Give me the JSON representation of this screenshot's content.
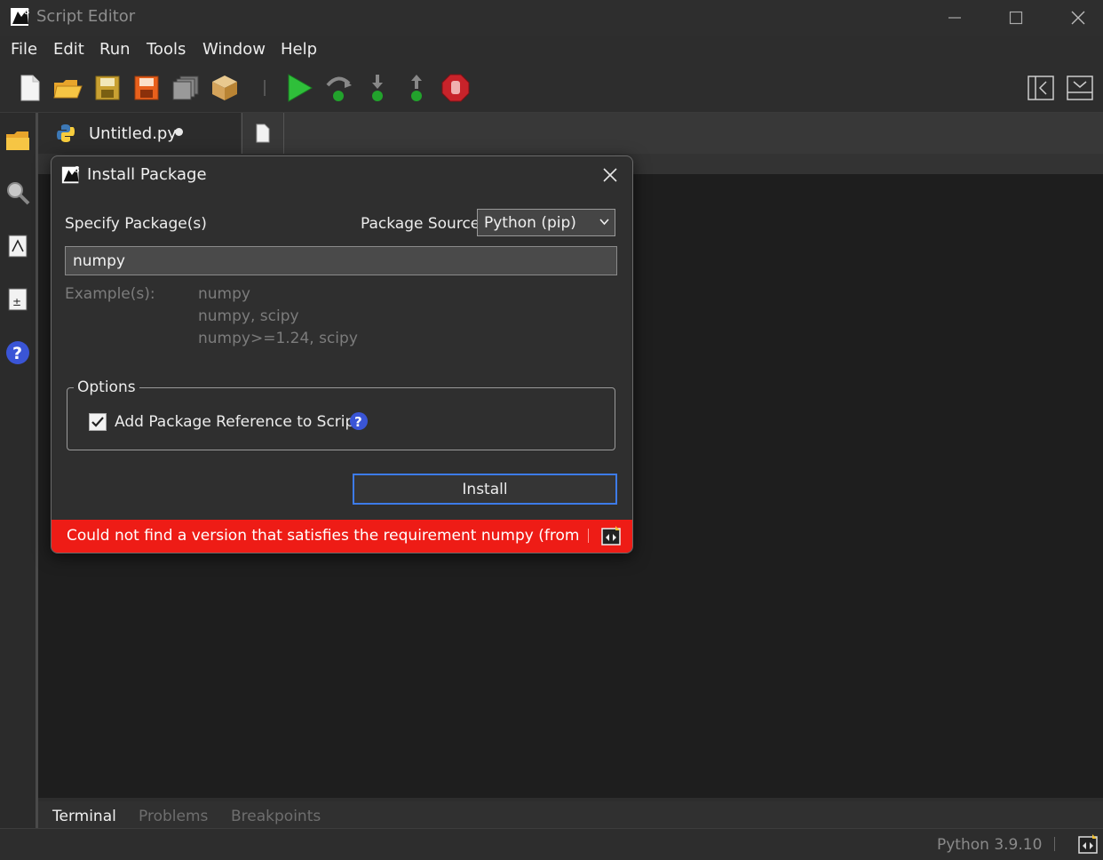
{
  "window": {
    "title": "Script Editor"
  },
  "menu": [
    "File",
    "Edit",
    "Run",
    "Tools",
    "Window",
    "Help"
  ],
  "tabs": {
    "file_tab_label": "Untitled.py"
  },
  "dialog": {
    "title": "Install Package",
    "specify_label": "Specify Package(s)",
    "source_label": "Package Source",
    "source_value": "Python (pip)",
    "package_input_value": "numpy",
    "examples_label": "Example(s):",
    "examples": [
      "numpy",
      "numpy, scipy",
      "numpy>=1.24, scipy"
    ],
    "options_legend": "Options",
    "add_reference_label": "Add Package Reference to Script",
    "add_reference_checked": true,
    "install_label": "Install",
    "error_message": "Could not find a version that satisfies the requirement numpy (from ver..."
  },
  "bottom_tabs": [
    "Terminal",
    "Problems",
    "Breakpoints"
  ],
  "status": {
    "python_version": "Python 3.9.10"
  },
  "colors": {
    "accent": "#3d7be8",
    "error": "#ee1c16",
    "editor_bg": "#1e1e1e"
  }
}
